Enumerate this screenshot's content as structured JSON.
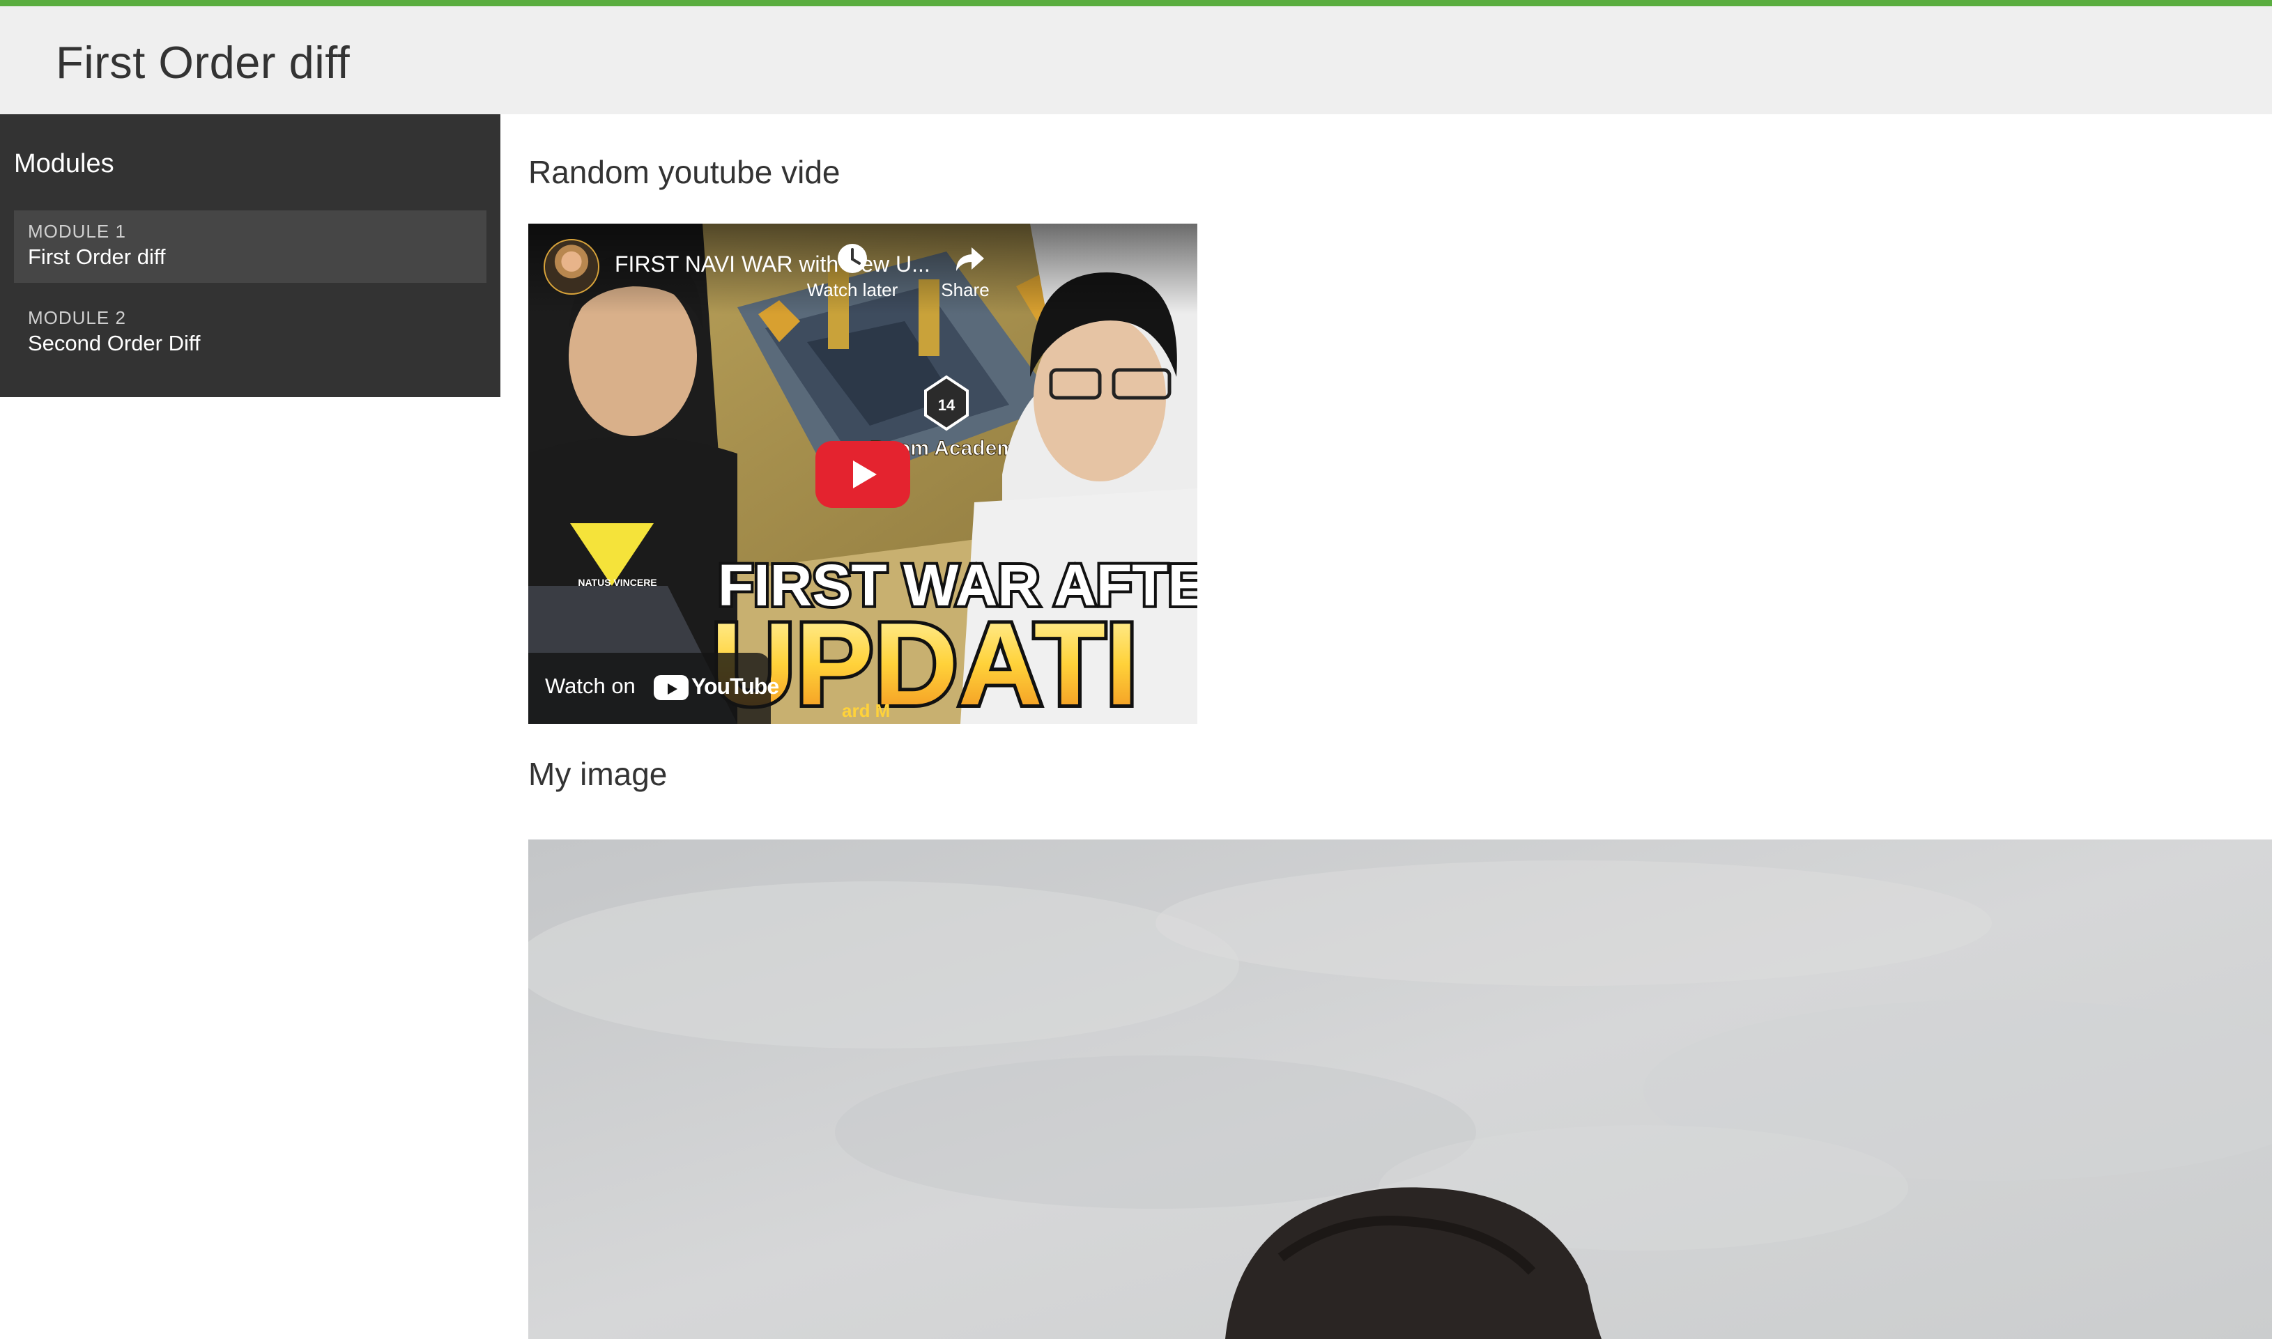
{
  "app": {
    "accent_color": "#5aad3f",
    "title": "First Order diff"
  },
  "sidebar": {
    "heading": "Modules",
    "items": [
      {
        "kicker": "MODULE 1",
        "label": "First Order diff",
        "active": true
      },
      {
        "kicker": "MODULE 2",
        "label": "Second Order Diff",
        "active": false
      }
    ]
  },
  "main": {
    "video_section_title": "Random youtube vide",
    "image_section_title": "My image"
  },
  "video": {
    "title": "FIRST NAVI WAR with New U...",
    "watch_later_label": "Watch later",
    "share_label": "Share",
    "watch_on_label": "Watch on",
    "youtube_label": "YouTube",
    "thumbnail_headline_1": "FIRST WAR AFTE",
    "thumbnail_headline_2": "UPDATI",
    "thumbnail_banner": "Boom Academy",
    "thumbnail_badge": "14",
    "thumbnail_jersey_text": "NATUS VINCERE",
    "thumbnail_corner_text": "ard M",
    "play_color": "#e4232f",
    "watch_later_icon": "clock-icon",
    "share_icon": "share-arrow-icon"
  }
}
